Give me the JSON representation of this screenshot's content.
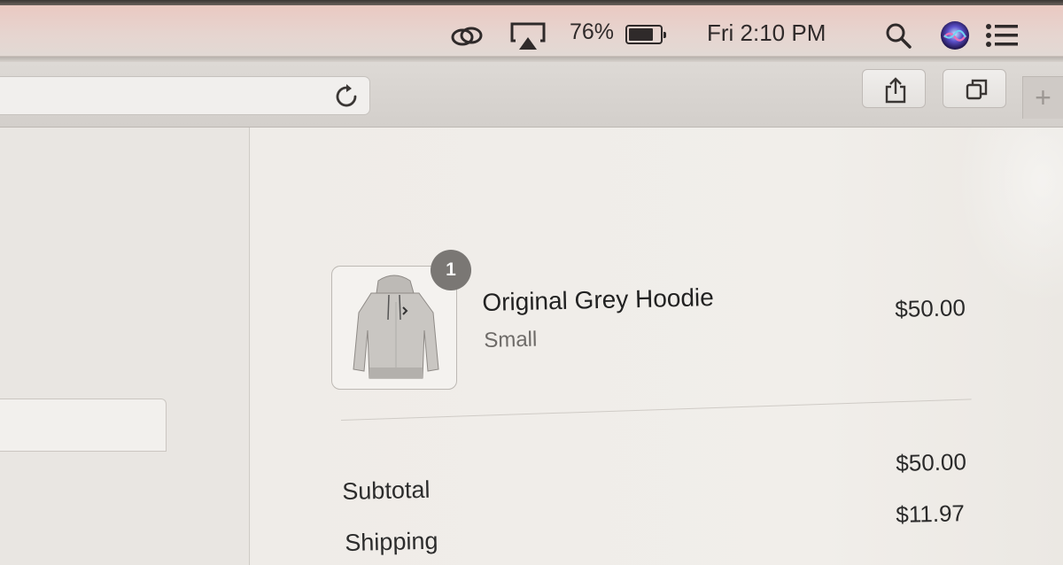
{
  "menubar": {
    "battery_percent": "76%",
    "battery_level": 0.76,
    "clock": "Fri 2:10 PM",
    "icons": [
      "sync-icon",
      "airplay-icon",
      "battery-icon",
      "spotlight-search-icon",
      "siri-icon",
      "notification-center-icon"
    ]
  },
  "toolbar": {
    "icons": [
      "reload-icon",
      "share-icon",
      "show-tabs-icon",
      "new-tab-icon"
    ],
    "new_tab_label": "+"
  },
  "cart": {
    "item": {
      "quantity": "1",
      "name": "Original Grey Hoodie",
      "variant": "Small",
      "price": "$50.00",
      "image_icon": "grey-hoodie-image"
    },
    "summary": {
      "subtotal_label": "Subtotal",
      "subtotal_value": "$50.00",
      "shipping_label": "Shipping",
      "shipping_value": "$11.97"
    }
  },
  "colors": {
    "menubar_tint": "#eac9c2",
    "badge": "#7a7774",
    "page_bg": "#eeebe7"
  }
}
